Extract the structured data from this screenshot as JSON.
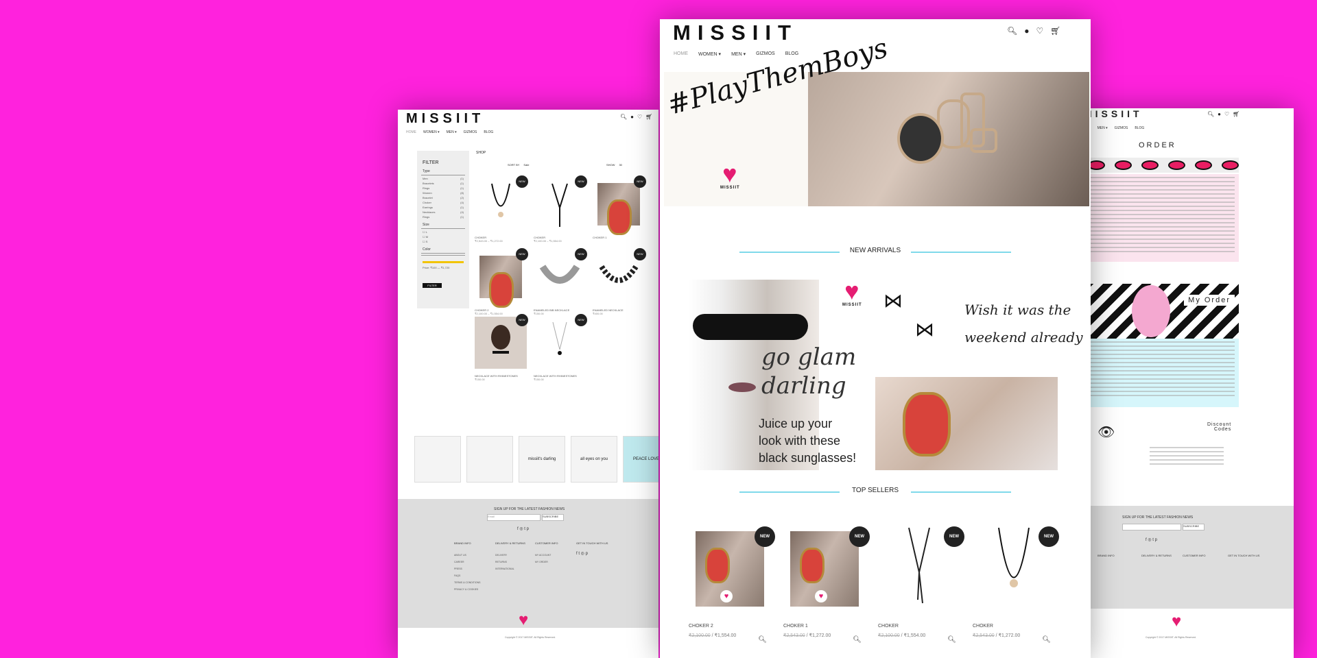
{
  "brand": "MISSIIT",
  "nav": [
    "HOME",
    "WOMEN ▾",
    "MEN ▾",
    "GIZMOS",
    "BLOG"
  ],
  "icons": [
    "search-icon",
    "account-icon",
    "heart-icon",
    "cart-icon"
  ],
  "colors": {
    "background": "#ff22dd",
    "accent_line": "#7fd9ea",
    "brand_pink": "#e51d72"
  },
  "hero": {
    "hashtag": "#PlayThemBoys",
    "logo_label": "MISSIIT"
  },
  "sections": {
    "new_arrivals": "NEW ARRIVALS",
    "top_sellers": "TOP SELLERS"
  },
  "collage": {
    "glam": "go glam\ndarling",
    "juice": "Juice up your\nlook with these\nblack sunglasses!",
    "wish": "Wish it was the\nweekend already",
    "logo_label": "MISSIIT"
  },
  "top_sellers": [
    {
      "name": "CHOKER 2",
      "old_price": "₹2,100.00",
      "price": "₹1,554.00",
      "badge": "NEW"
    },
    {
      "name": "CHOKER 1",
      "old_price": "₹2,543.00",
      "price": "₹1,272.00",
      "badge": "NEW"
    },
    {
      "name": "CHOKER",
      "old_price": "₹2,100.00",
      "price": "₹1,554.00",
      "badge": "NEW"
    },
    {
      "name": "CHOKER",
      "old_price": "₹2,543.00",
      "price": "₹1,272.00",
      "badge": "NEW"
    }
  ],
  "left": {
    "filter_title": "FILTER",
    "type_label": "Type",
    "types": [
      "Men",
      "Bracelets",
      "Rings",
      "Women",
      "Bracelet",
      "Choker",
      "Earrings",
      "Necklaces",
      "Rings"
    ],
    "size_label": "Size",
    "sizes": [
      "L",
      "M",
      "S"
    ],
    "color_label": "Color",
    "price_label": "Price: ₹100 — ₹1,720",
    "filter_button": "FILTER",
    "shop_title": "SHOP",
    "sort_by": "SORT BY",
    "sort_value": "Sale",
    "show": "SHOW",
    "show_value": "30",
    "products": [
      {
        "name": "CHOKER",
        "price": "₹2,543.00 – ₹1,272.00"
      },
      {
        "name": "CHOKER",
        "price": "₹2,100.00 – ₹1,554.00"
      },
      {
        "name": "CHOKER 1",
        "price": ""
      },
      {
        "name": "CHOKER 2",
        "price": "₹2,100.00 – ₹1,554.00"
      },
      {
        "name": "ENAMELED BIB NECKLACE",
        "price": "₹150.00"
      },
      {
        "name": "ENAMELED NECKLACE",
        "price": "₹400.00"
      },
      {
        "name": "NECKLACE WITH RHINESTONES",
        "price": "₹150.00"
      },
      {
        "name": "NECKLACE WITH RHINESTONES",
        "price": "₹150.00"
      }
    ],
    "strip": [
      "",
      "",
      "missiit's darling",
      "all eyes on you",
      "PEACE LOVE"
    ],
    "signup": "SIGN UP FOR THE LATEST FASHION NEWS",
    "email_placeholder": "Email",
    "subscribe": "SUBSCRIBE",
    "columns": [
      {
        "head": "BRAND INFO",
        "items": [
          "ABOUT US",
          "CAREER",
          "PRESS",
          "FAQS",
          "TERMS & CONDITIONS",
          "PRIVACY & COOKIES"
        ]
      },
      {
        "head": "DELIVERY & RETURNS",
        "items": [
          "DELIVERY",
          "RETURNS",
          "INTERNATIONAL"
        ]
      },
      {
        "head": "CUSTOMER INFO",
        "items": [
          "MY ACCOUNT",
          "MY ORDER"
        ]
      },
      {
        "head": "GET IN TOUCH WITH US",
        "items": []
      }
    ],
    "copyright": "Copyright © 2017 MISSIIT. All Rights Reserved."
  },
  "right": {
    "order_title": "ORDER",
    "my_order": "My Order",
    "discount": "Discount\nCodes",
    "signup": "SIGN UP FOR THE LATEST FASHION NEWS",
    "subscribe": "SUBSCRIBE",
    "copyright": "Copyright © 2017 MISSIIT. All Rights Reserved."
  }
}
